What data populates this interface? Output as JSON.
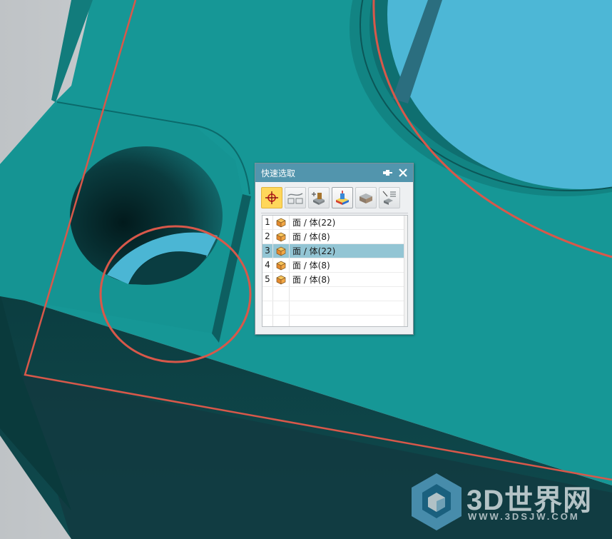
{
  "dialog": {
    "title": "快速选取",
    "pin_icon": "pin-icon",
    "close_icon": "close-icon"
  },
  "toolbar": {
    "filters": [
      {
        "name": "all-filter",
        "icon": "crosshair-target-icon",
        "state": "active"
      },
      {
        "name": "curve-filter",
        "icon": "curve-edge-icon",
        "state": "normal"
      },
      {
        "name": "feature-filter",
        "icon": "feature-extrude-icon",
        "state": "normal"
      },
      {
        "name": "body-filter",
        "icon": "solid-body-icon",
        "state": "pressed"
      },
      {
        "name": "component-filter",
        "icon": "component-icon",
        "state": "normal"
      },
      {
        "name": "other-filter",
        "icon": "list-select-icon",
        "state": "normal"
      }
    ]
  },
  "list": {
    "rows": [
      {
        "num": "1",
        "label": "面 / 体(22)",
        "icon": "body-cube-icon",
        "selected": false
      },
      {
        "num": "2",
        "label": "面 / 体(8)",
        "icon": "body-cube-icon",
        "selected": false
      },
      {
        "num": "3",
        "label": "面 / 体(22)",
        "icon": "body-cube-icon",
        "selected": true
      },
      {
        "num": "4",
        "label": "面 / 体(8)",
        "icon": "body-cube-icon",
        "selected": false
      },
      {
        "num": "5",
        "label": "面 / 体(8)",
        "icon": "body-cube-icon",
        "selected": false
      }
    ]
  },
  "watermark": {
    "brand": "3D世界网",
    "url": "WWW.3DSJW.COM"
  },
  "colors": {
    "model_top": "#169796",
    "model_side_dark": "#0a3a3c",
    "hole_blue": "#4bb6d4",
    "highlight_red": "#d8584a",
    "dialog_title": "#5295ad",
    "selected_row": "#93c5d4"
  }
}
